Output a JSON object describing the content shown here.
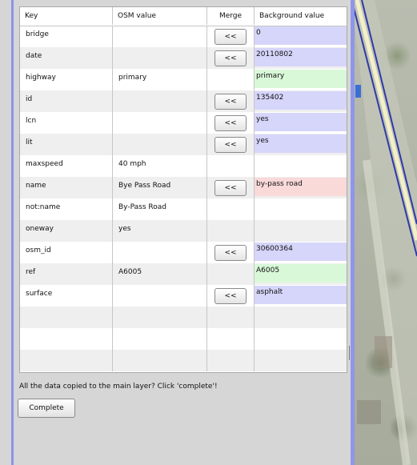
{
  "table": {
    "headers": {
      "key": "Key",
      "osm": "OSM value",
      "merge": "Merge",
      "background": "Background value"
    },
    "rows": [
      {
        "key": "bridge",
        "osm": "",
        "merge": "<<",
        "background": "0",
        "bg": "blue"
      },
      {
        "key": "date",
        "osm": "",
        "merge": "<<",
        "background": "20110802",
        "bg": "blue"
      },
      {
        "key": "highway",
        "osm": "primary",
        "merge": "",
        "background": "primary",
        "bg": "green"
      },
      {
        "key": "id",
        "osm": "",
        "merge": "<<",
        "background": "135402",
        "bg": "blue"
      },
      {
        "key": "lcn",
        "osm": "",
        "merge": "<<",
        "background": "yes",
        "bg": "blue"
      },
      {
        "key": "lit",
        "osm": "",
        "merge": "<<",
        "background": "yes",
        "bg": "blue"
      },
      {
        "key": "maxspeed",
        "osm": "40 mph",
        "merge": "",
        "background": "",
        "bg": ""
      },
      {
        "key": "name",
        "osm": "Bye Pass Road",
        "merge": "<<",
        "background": "by-pass road",
        "bg": "red"
      },
      {
        "key": "not:name",
        "osm": "By-Pass Road",
        "merge": "",
        "background": "",
        "bg": ""
      },
      {
        "key": "oneway",
        "osm": "yes",
        "merge": "",
        "background": "",
        "bg": ""
      },
      {
        "key": "osm_id",
        "osm": "",
        "merge": "<<",
        "background": "30600364",
        "bg": "blue"
      },
      {
        "key": "ref",
        "osm": "A6005",
        "merge": "",
        "background": "A6005",
        "bg": "green"
      },
      {
        "key": "surface",
        "osm": "",
        "merge": "<<",
        "background": "asphalt",
        "bg": "blue"
      }
    ],
    "empty_rows": 3
  },
  "status_message": "All the data copied to the main layer? Click 'complete'!",
  "complete_label": "Complete",
  "colors": {
    "match_blue": "#d6d5fa",
    "match_green": "#d8f8d8",
    "conflict_red": "#fad9d9",
    "frame_blue": "#8d95e8"
  }
}
